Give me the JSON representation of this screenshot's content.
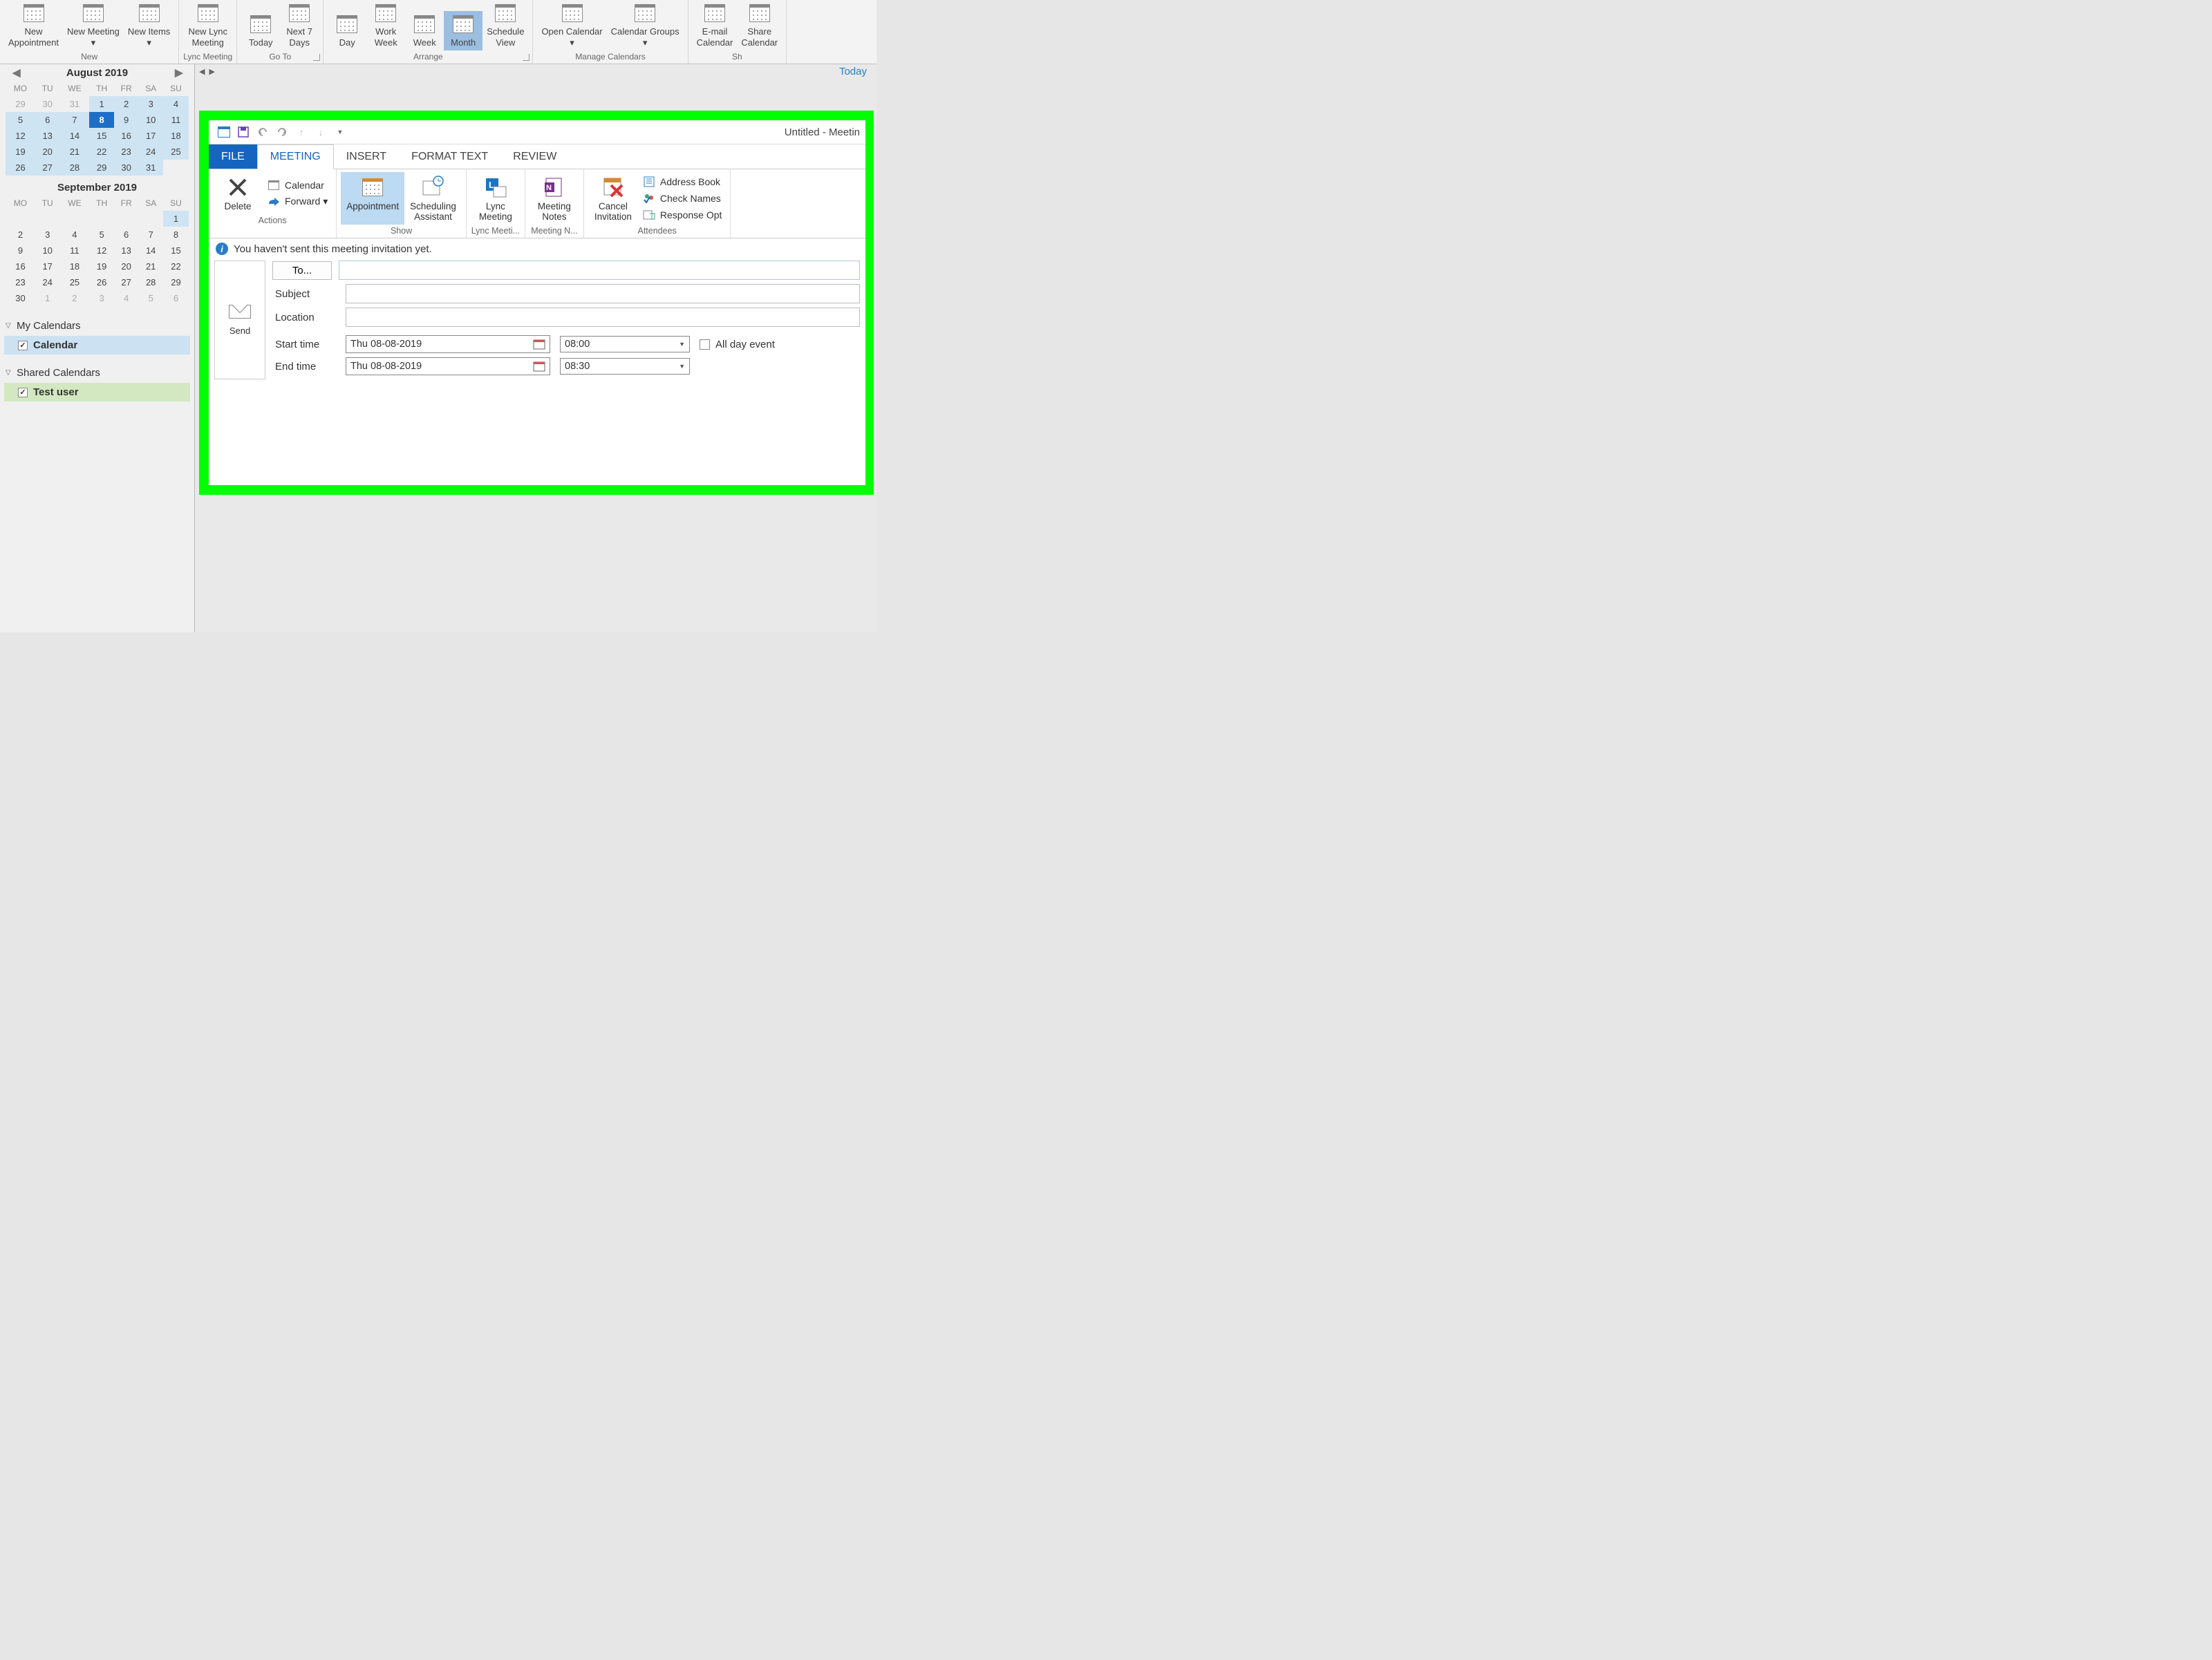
{
  "main_ribbon": {
    "groups": [
      {
        "label": "New",
        "items": [
          "New Appointment",
          "New Meeting ▾",
          "New Items ▾"
        ]
      },
      {
        "label": "Lync Meeting",
        "items": [
          "New Lync Meeting"
        ]
      },
      {
        "label": "Go To",
        "items": [
          "Today",
          "Next 7 Days"
        ],
        "launcher": true
      },
      {
        "label": "Arrange",
        "items": [
          "Day",
          "Work Week",
          "Week",
          "Month",
          "Schedule View"
        ],
        "selected_index": 3,
        "launcher": true
      },
      {
        "label": "Manage Calendars",
        "items": [
          "Open Calendar ▾",
          "Calendar Groups ▾"
        ]
      },
      {
        "label": "Sh",
        "items": [
          "E-mail Calendar",
          "Share Calendar"
        ]
      }
    ]
  },
  "left_pane": {
    "months": [
      {
        "title": "August 2019",
        "dow": [
          "MO",
          "TU",
          "WE",
          "TH",
          "FR",
          "SA",
          "SU"
        ],
        "weeks": [
          [
            {
              "d": 29,
              "dim": 1
            },
            {
              "d": 30,
              "dim": 1
            },
            {
              "d": 31,
              "dim": 1
            },
            {
              "d": 1,
              "hl": 1
            },
            {
              "d": 2,
              "hl": 1
            },
            {
              "d": 3,
              "hl": 1
            },
            {
              "d": 4,
              "hl": 1
            }
          ],
          [
            {
              "d": 5,
              "hl": 1
            },
            {
              "d": 6,
              "hl": 1
            },
            {
              "d": 7,
              "hl": 1
            },
            {
              "d": 8,
              "today": 1
            },
            {
              "d": 9,
              "hl": 1
            },
            {
              "d": 10,
              "hl": 1
            },
            {
              "d": 11,
              "hl": 1
            }
          ],
          [
            {
              "d": 12,
              "hl": 1
            },
            {
              "d": 13,
              "hl": 1
            },
            {
              "d": 14,
              "hl": 1
            },
            {
              "d": 15,
              "hl": 1
            },
            {
              "d": 16,
              "hl": 1
            },
            {
              "d": 17,
              "hl": 1
            },
            {
              "d": 18,
              "hl": 1
            }
          ],
          [
            {
              "d": 19,
              "hl": 1
            },
            {
              "d": 20,
              "hl": 1
            },
            {
              "d": 21,
              "hl": 1
            },
            {
              "d": 22,
              "hl": 1
            },
            {
              "d": 23,
              "hl": 1
            },
            {
              "d": 24,
              "hl": 1
            },
            {
              "d": 25,
              "hl": 1
            }
          ],
          [
            {
              "d": 26,
              "hl": 1
            },
            {
              "d": 27,
              "hl": 1
            },
            {
              "d": 28,
              "hl": 1
            },
            {
              "d": 29,
              "hl": 1
            },
            {
              "d": 30,
              "hl": 1
            },
            {
              "d": 31,
              "hl": 1
            },
            {
              "d": "",
              "dim": 1
            }
          ]
        ]
      },
      {
        "title": "September 2019",
        "dow": [
          "MO",
          "TU",
          "WE",
          "TH",
          "FR",
          "SA",
          "SU"
        ],
        "weeks": [
          [
            {
              "d": ""
            },
            {
              "d": ""
            },
            {
              "d": ""
            },
            {
              "d": ""
            },
            {
              "d": ""
            },
            {
              "d": ""
            },
            {
              "d": 1,
              "hl": 1
            }
          ],
          [
            {
              "d": 2
            },
            {
              "d": 3
            },
            {
              "d": 4
            },
            {
              "d": 5
            },
            {
              "d": 6
            },
            {
              "d": 7
            },
            {
              "d": 8
            }
          ],
          [
            {
              "d": 9
            },
            {
              "d": 10
            },
            {
              "d": 11
            },
            {
              "d": 12
            },
            {
              "d": 13
            },
            {
              "d": 14
            },
            {
              "d": 15
            }
          ],
          [
            {
              "d": 16
            },
            {
              "d": 17
            },
            {
              "d": 18
            },
            {
              "d": 19
            },
            {
              "d": 20
            },
            {
              "d": 21
            },
            {
              "d": 22
            }
          ],
          [
            {
              "d": 23
            },
            {
              "d": 24
            },
            {
              "d": 25
            },
            {
              "d": 26
            },
            {
              "d": 27
            },
            {
              "d": 28
            },
            {
              "d": 29
            }
          ],
          [
            {
              "d": 30
            },
            {
              "d": 1,
              "dim": 1
            },
            {
              "d": 2,
              "dim": 1
            },
            {
              "d": 3,
              "dim": 1
            },
            {
              "d": 4,
              "dim": 1
            },
            {
              "d": 5,
              "dim": 1
            },
            {
              "d": 6,
              "dim": 1
            }
          ]
        ]
      }
    ],
    "sections": [
      {
        "label": "My Calendars",
        "items": [
          {
            "label": "Calendar",
            "selected": "selected"
          }
        ]
      },
      {
        "label": "Shared Calendars",
        "items": [
          {
            "label": "Test user",
            "selected": "sel2"
          }
        ]
      }
    ]
  },
  "dialog": {
    "title": "Untitled - Meetin",
    "tabs": [
      "FILE",
      "MEETING",
      "INSERT",
      "FORMAT TEXT",
      "REVIEW"
    ],
    "active_tab_index": 1,
    "ribbon_groups": [
      {
        "label": "Actions",
        "big": [
          {
            "label": "Delete",
            "icon": "delete-icon"
          }
        ],
        "small": [
          {
            "label": "Calendar",
            "icon": "calendar-small-icon"
          },
          {
            "label": "Forward  ▾",
            "icon": "forward-icon"
          }
        ]
      },
      {
        "label": "Show",
        "big": [
          {
            "label": "Appointment",
            "icon": "appointment-icon",
            "selected": true
          },
          {
            "label": "Scheduling Assistant",
            "icon": "scheduling-icon"
          }
        ]
      },
      {
        "label": "Lync Meeti...",
        "big": [
          {
            "label": "Lync Meeting",
            "icon": "lync-icon"
          }
        ]
      },
      {
        "label": "Meeting N...",
        "big": [
          {
            "label": "Meeting Notes",
            "icon": "onenote-icon"
          }
        ]
      },
      {
        "label": "Attendees",
        "big": [
          {
            "label": "Cancel Invitation",
            "icon": "cancel-icon"
          }
        ],
        "small": [
          {
            "label": "Address Book",
            "icon": "addressbook-icon"
          },
          {
            "label": "Check Names",
            "icon": "checknames-icon"
          },
          {
            "label": "Response Opt",
            "icon": "response-icon"
          }
        ]
      }
    ],
    "info_text": "You haven't sent this meeting invitation yet.",
    "send_label": "Send",
    "form": {
      "to_button": "To...",
      "to_value": "",
      "subject_label": "Subject",
      "subject_value": "",
      "location_label": "Location",
      "location_value": "",
      "start_label": "Start time",
      "start_date": "Thu 08-08-2019",
      "start_time": "08:00",
      "end_label": "End time",
      "end_date": "Thu 08-08-2019",
      "end_time": "08:30",
      "all_day_label": "All day event",
      "all_day_checked": false
    }
  },
  "today_link": "Today"
}
